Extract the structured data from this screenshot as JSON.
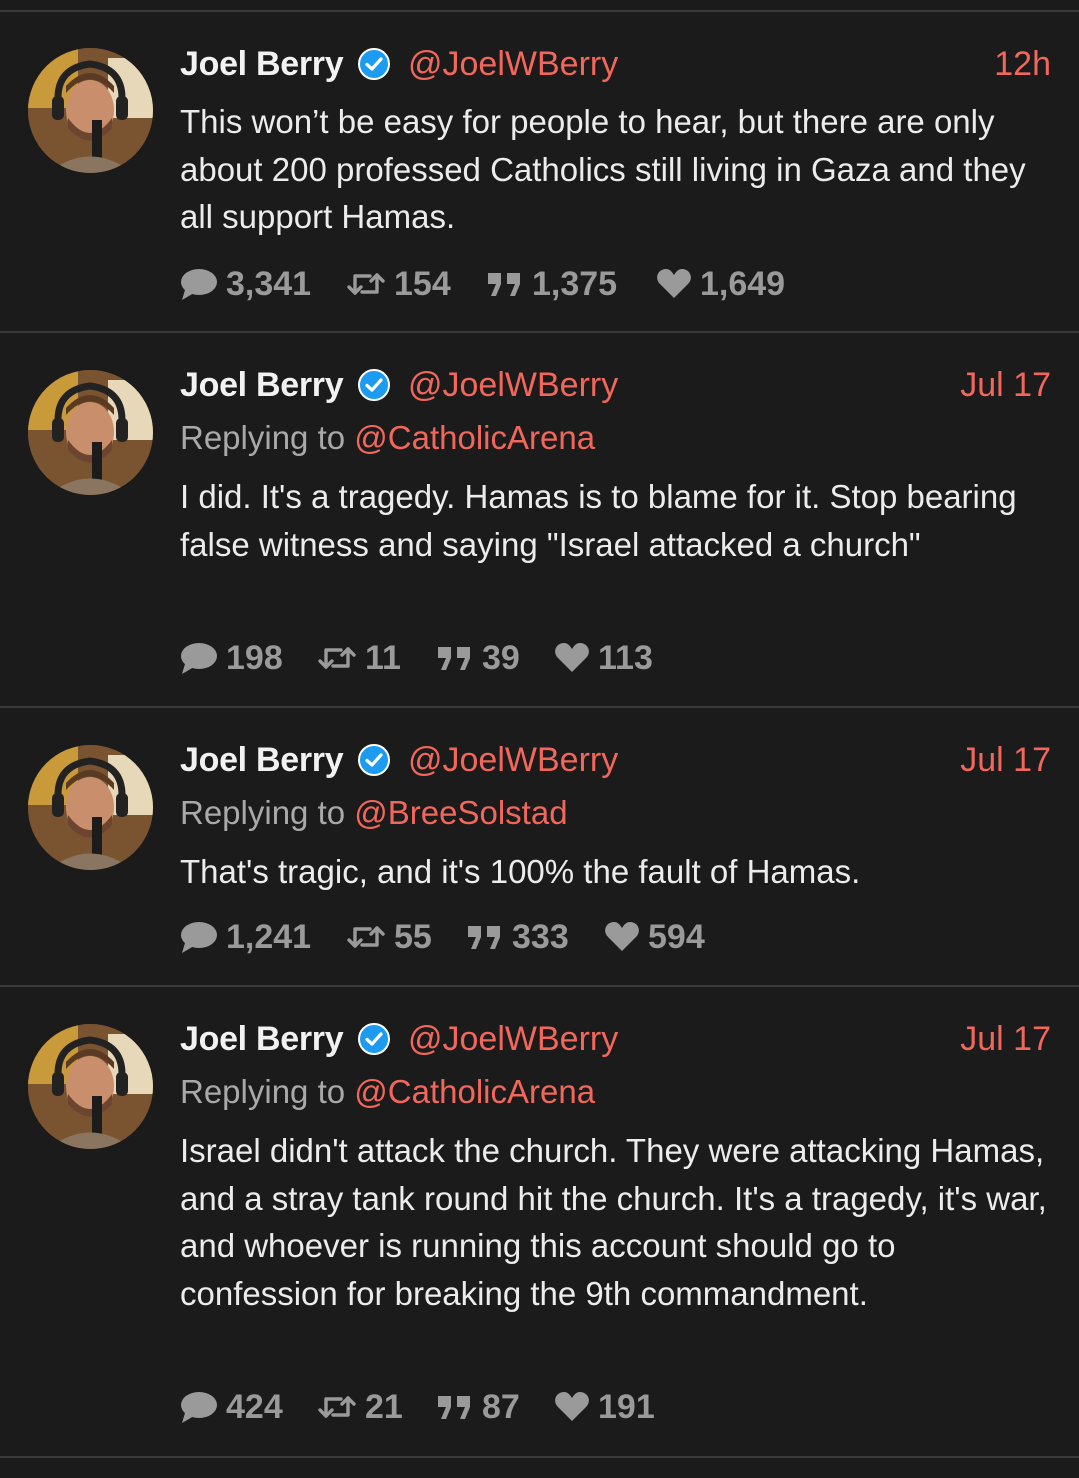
{
  "tweets": [
    {
      "name": "Joel Berry",
      "handle": "@JoelWBerry",
      "time": "12h",
      "reply_prefix": "",
      "reply_to": "",
      "text": "This won’t be easy for people to hear, but there are only about 200 professed Catholics still living in Gaza and they all support Hamas.",
      "replies": "3,341",
      "retweets": "154",
      "quotes": "1,375",
      "likes": "1,649"
    },
    {
      "name": "Joel Berry",
      "handle": "@JoelWBerry",
      "time": "Jul 17",
      "reply_prefix": "Replying to",
      "reply_to": "@CatholicArena",
      "text": "I did. It's a tragedy. Hamas is to blame for it. Stop bearing false witness and saying \"Israel attacked a church\"",
      "replies": "198",
      "retweets": "11",
      "quotes": "39",
      "likes": "113"
    },
    {
      "name": "Joel Berry",
      "handle": "@JoelWBerry",
      "time": "Jul 17",
      "reply_prefix": "Replying to",
      "reply_to": "@BreeSolstad",
      "text": "That's tragic, and it's 100% the fault of Hamas.",
      "replies": "1,241",
      "retweets": "55",
      "quotes": "333",
      "likes": "594"
    },
    {
      "name": "Joel Berry",
      "handle": "@JoelWBerry",
      "time": "Jul 17",
      "reply_prefix": "Replying to",
      "reply_to": "@CatholicArena",
      "text": "Israel didn't attack the church. They were attacking Hamas, and a stray tank round hit the church. It's a tragedy, it's war, and whoever is running this account should go to confession for breaking the 9th commandment.",
      "replies": "424",
      "retweets": "21",
      "quotes": "87",
      "likes": "191"
    }
  ],
  "icons": {
    "reply": "speech-bubble-icon",
    "retweet": "retweet-icon",
    "quote": "quote-icon",
    "like": "heart-icon",
    "verified": "verified-badge-icon"
  },
  "colors": {
    "background": "#1b1b1b",
    "accent": "#f2675c",
    "verified": "#1d9bf0",
    "muted": "#9a9a9a"
  }
}
